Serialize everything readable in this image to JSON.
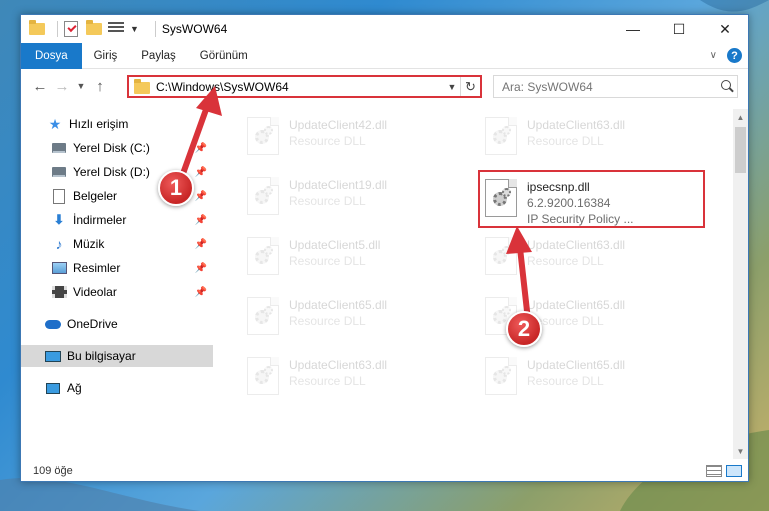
{
  "window": {
    "title": "SysWOW64",
    "controls": {
      "minimize": "—",
      "maximize": "☐",
      "close": "✕"
    }
  },
  "ribbon": {
    "tabs": [
      {
        "label": "Dosya"
      },
      {
        "label": "Giriş"
      },
      {
        "label": "Paylaş"
      },
      {
        "label": "Görünüm"
      }
    ],
    "help": "?"
  },
  "address": {
    "path": "C:\\Windows\\SysWOW64"
  },
  "search": {
    "placeholder": "Ara: SysWOW64"
  },
  "sidebar": {
    "items": [
      {
        "label": "Hızlı erişim",
        "icon": "star-icon"
      },
      {
        "label": "Yerel Disk (C:)",
        "icon": "disk-icon",
        "pinned": true
      },
      {
        "label": "Yerel Disk (D:)",
        "icon": "disk-icon",
        "pinned": true
      },
      {
        "label": "Belgeler",
        "icon": "documents-icon",
        "pinned": true
      },
      {
        "label": "İndirmeler",
        "icon": "download-icon",
        "pinned": true
      },
      {
        "label": "Müzik",
        "icon": "music-icon",
        "pinned": true
      },
      {
        "label": "Resimler",
        "icon": "pictures-icon",
        "pinned": true
      },
      {
        "label": "Videolar",
        "icon": "videos-icon",
        "pinned": true
      },
      {
        "label": "OneDrive",
        "icon": "cloud-icon"
      },
      {
        "label": "Bu bilgisayar",
        "icon": "computer-icon",
        "selected": true
      },
      {
        "label": "Ağ",
        "icon": "network-icon"
      }
    ]
  },
  "files": [
    {
      "name": "UpdateClient42.dll",
      "type": "Resource DLL"
    },
    {
      "name": "UpdateClient63.dll",
      "type": "Resource DLL"
    },
    {
      "name": "UpdateClient19.dll",
      "type": "Resource DLL"
    },
    {
      "name": "ipsecsnp.dll",
      "version": "6.2.9200.16384",
      "description": "IP Security Policy ..."
    },
    {
      "name": "UpdateClient5.dll",
      "type": "Resource DLL"
    },
    {
      "name": "UpdateClient63.dll",
      "type": "Resource DLL"
    },
    {
      "name": "UpdateClient65.dll",
      "type": "Resource DLL"
    },
    {
      "name": "UpdateClient65.dll",
      "type": "Resource DLL"
    },
    {
      "name": "UpdateClient63.dll",
      "type": "Resource DLL"
    },
    {
      "name": "UpdateClient65.dll",
      "type": "Resource DLL"
    }
  ],
  "status": {
    "count": "109 öğe"
  },
  "annotations": {
    "step1": "1",
    "step2": "2",
    "color": "#d9333a"
  }
}
